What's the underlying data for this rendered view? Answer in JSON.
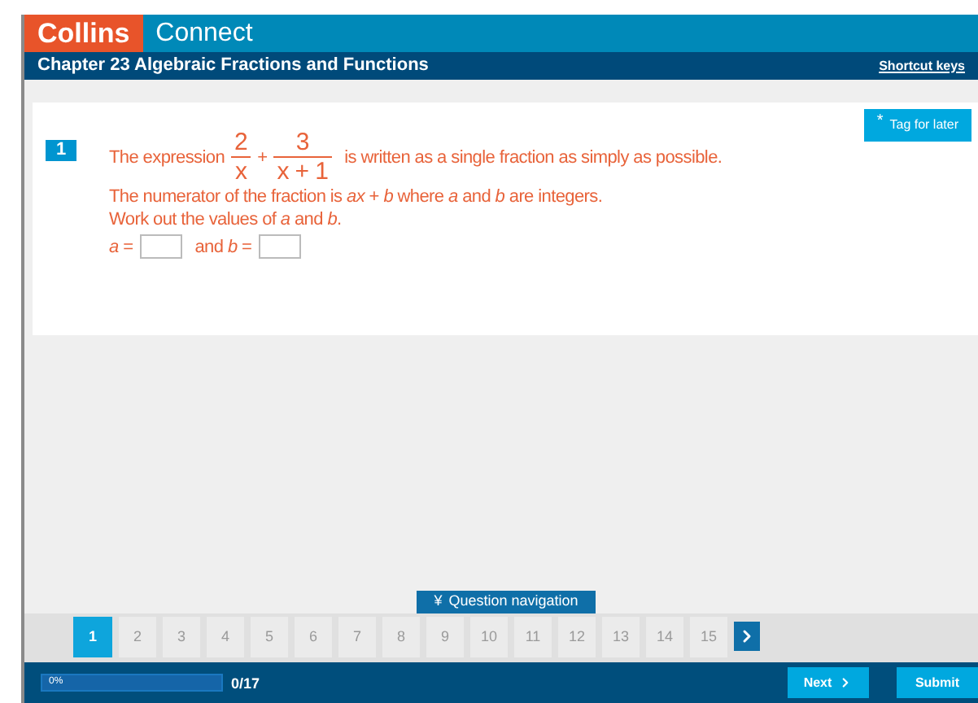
{
  "header": {
    "brand": "Collins",
    "product": "Connect"
  },
  "chapter_bar": {
    "title": "Chapter 23 Algebraic Fractions and Functions",
    "link": "Shortcut keys"
  },
  "tag_button": {
    "icon": "*",
    "label": "Tag for later"
  },
  "question": {
    "number": "1",
    "expression": {
      "before": "The expression",
      "fraction_1": {
        "numerator": "2",
        "denominator": "x"
      },
      "operator": "+",
      "fraction_2": {
        "numerator": "3",
        "denominator": "x + 1"
      },
      "after": "is written as a single fraction as simply as possible."
    },
    "lines": [
      "The numerator of the fraction is *ax* + *b* where *a* and *b* are integers.",
      "Work out the values of *a* and *b*."
    ],
    "answers": [
      {
        "label": "*a* ="
      },
      {
        "label": "and *b* ="
      }
    ]
  },
  "navigation_toggle": {
    "icon": "¥",
    "label": "Question navigation"
  },
  "pages": [
    {
      "label": "1",
      "selected": true
    },
    {
      "label": "2",
      "selected": false
    },
    {
      "label": "3",
      "selected": false
    },
    {
      "label": "4",
      "selected": false
    },
    {
      "label": "5",
      "selected": false
    },
    {
      "label": "6",
      "selected": false
    },
    {
      "label": "7",
      "selected": false
    },
    {
      "label": "8",
      "selected": false
    },
    {
      "label": "9",
      "selected": false
    },
    {
      "label": "10",
      "selected": false
    },
    {
      "label": "11",
      "selected": false
    },
    {
      "label": "12",
      "selected": false
    },
    {
      "label": "13",
      "selected": false
    },
    {
      "label": "14",
      "selected": false
    },
    {
      "label": "15",
      "selected": false
    }
  ],
  "footer": {
    "progress": {
      "label": "0%",
      "level": 0
    },
    "count": "0/17",
    "next": "Next",
    "submit": "Submit"
  }
}
